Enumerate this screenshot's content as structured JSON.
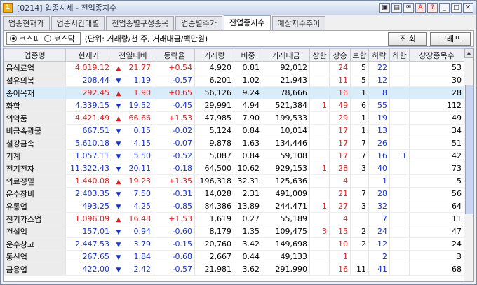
{
  "window": {
    "title": "[0214] 업종시세 - 전업종지수",
    "app_icon": "1"
  },
  "title_buttons": [
    "▣",
    "▤",
    "✉",
    "A",
    "?",
    "_",
    "□",
    "✕"
  ],
  "tabs": [
    {
      "label": "업종현재가"
    },
    {
      "label": "업종시간대별"
    },
    {
      "label": "전업종별구성종목"
    },
    {
      "label": "업종별주가"
    },
    {
      "label": "전업종지수"
    },
    {
      "label": "예상지수추이"
    }
  ],
  "active_tab": 4,
  "market": {
    "option1": "코스피",
    "option2": "코스닥",
    "selected": "코스피"
  },
  "unit_text": "(단위: 거래량/천 주, 거래대금/백만원)",
  "buttons": {
    "query": "조  회",
    "graph": "그래프"
  },
  "colors": {
    "up": "#e02020",
    "down": "#1530d0",
    "selected_row": "#d9ecfa"
  },
  "columns": [
    "업종명",
    "현재가",
    "전일대비",
    "등락율",
    "거래량",
    "비중",
    "거래대금",
    "상한",
    "상승",
    "보합",
    "하락",
    "하한",
    "상장종목수"
  ],
  "rows": [
    {
      "name": "음식료업",
      "price": "4,019.12",
      "dir": "up",
      "change": "21.77",
      "rate": "+0.54",
      "volume": "4,920",
      "weight": "0.81",
      "amount": "92,012",
      "upper": "",
      "rise": "24",
      "flat": "5",
      "fall": "22",
      "lower": "",
      "listed": "53"
    },
    {
      "name": "섬유의복",
      "price": "208.44",
      "dir": "down",
      "change": "1.19",
      "rate": "-0.57",
      "volume": "6,201",
      "weight": "1.02",
      "amount": "21,943",
      "upper": "",
      "rise": "11",
      "flat": "5",
      "fall": "12",
      "lower": "",
      "listed": "30"
    },
    {
      "name": "종이목재",
      "price": "292.45",
      "dir": "up",
      "change": "1.90",
      "rate": "+0.65",
      "volume": "56,126",
      "weight": "9.24",
      "amount": "78,666",
      "upper": "",
      "rise": "16",
      "flat": "1",
      "fall": "8",
      "lower": "",
      "listed": "28"
    },
    {
      "name": "화학",
      "price": "4,339.15",
      "dir": "down",
      "change": "19.52",
      "rate": "-0.45",
      "volume": "29,991",
      "weight": "4.94",
      "amount": "521,384",
      "upper": "1",
      "rise": "49",
      "flat": "6",
      "fall": "55",
      "lower": "",
      "listed": "112"
    },
    {
      "name": "의약품",
      "price": "4,421.49",
      "dir": "up",
      "change": "66.66",
      "rate": "+1.53",
      "volume": "47,985",
      "weight": "7.90",
      "amount": "199,533",
      "upper": "",
      "rise": "29",
      "flat": "1",
      "fall": "19",
      "lower": "",
      "listed": "49"
    },
    {
      "name": "비금속광물",
      "price": "667.51",
      "dir": "down",
      "change": "0.15",
      "rate": "-0.02",
      "volume": "5,124",
      "weight": "0.84",
      "amount": "10,014",
      "upper": "",
      "rise": "17",
      "flat": "1",
      "fall": "13",
      "lower": "",
      "listed": "34"
    },
    {
      "name": "철강금속",
      "price": "5,610.18",
      "dir": "down",
      "change": "4.15",
      "rate": "-0.07",
      "volume": "9,878",
      "weight": "1.63",
      "amount": "134,446",
      "upper": "",
      "rise": "17",
      "flat": "7",
      "fall": "26",
      "lower": "",
      "listed": "51"
    },
    {
      "name": "기계",
      "price": "1,057.11",
      "dir": "down",
      "change": "5.50",
      "rate": "-0.52",
      "volume": "5,087",
      "weight": "0.84",
      "amount": "59,108",
      "upper": "",
      "rise": "17",
      "flat": "7",
      "fall": "16",
      "lower": "1",
      "listed": "42"
    },
    {
      "name": "전기전자",
      "price": "11,322.43",
      "dir": "down",
      "change": "20.11",
      "rate": "-0.18",
      "volume": "64,500",
      "weight": "10.62",
      "amount": "929,153",
      "upper": "1",
      "rise": "28",
      "flat": "3",
      "fall": "40",
      "lower": "",
      "listed": "73"
    },
    {
      "name": "의료정밀",
      "price": "1,440.08",
      "dir": "up",
      "change": "19.23",
      "rate": "+1.35",
      "volume": "196,318",
      "weight": "32.31",
      "amount": "125,636",
      "upper": "",
      "rise": "4",
      "flat": "",
      "fall": "1",
      "lower": "",
      "listed": "5"
    },
    {
      "name": "운수장비",
      "price": "2,403.35",
      "dir": "down",
      "change": "7.50",
      "rate": "-0.31",
      "volume": "14,028",
      "weight": "2.31",
      "amount": "491,009",
      "upper": "",
      "rise": "21",
      "flat": "7",
      "fall": "28",
      "lower": "",
      "listed": "56"
    },
    {
      "name": "유통업",
      "price": "493.25",
      "dir": "down",
      "change": "4.25",
      "rate": "-0.85",
      "volume": "84,386",
      "weight": "13.89",
      "amount": "244,471",
      "upper": "1",
      "rise": "27",
      "flat": "3",
      "fall": "32",
      "lower": "",
      "listed": "64"
    },
    {
      "name": "전기가스업",
      "price": "1,096.09",
      "dir": "up",
      "change": "16.48",
      "rate": "+1.53",
      "volume": "1,619",
      "weight": "0.27",
      "amount": "55,189",
      "upper": "",
      "rise": "4",
      "flat": "",
      "fall": "7",
      "lower": "",
      "listed": "11"
    },
    {
      "name": "건설업",
      "price": "157.01",
      "dir": "down",
      "change": "0.94",
      "rate": "-0.60",
      "volume": "8,179",
      "weight": "1.35",
      "amount": "109,475",
      "upper": "3",
      "rise": "15",
      "flat": "2",
      "fall": "24",
      "lower": "",
      "listed": "47"
    },
    {
      "name": "운수창고",
      "price": "2,447.53",
      "dir": "down",
      "change": "3.79",
      "rate": "-0.15",
      "volume": "20,760",
      "weight": "3.42",
      "amount": "149,698",
      "upper": "",
      "rise": "10",
      "flat": "2",
      "fall": "12",
      "lower": "",
      "listed": "24"
    },
    {
      "name": "통신업",
      "price": "267.65",
      "dir": "down",
      "change": "1.84",
      "rate": "-0.68",
      "volume": "2,667",
      "weight": "0.44",
      "amount": "49,133",
      "upper": "",
      "rise": "1",
      "flat": "",
      "fall": "2",
      "lower": "",
      "listed": "3"
    },
    {
      "name": "금융업",
      "price": "422.00",
      "dir": "down",
      "change": "2.42",
      "rate": "-0.57",
      "volume": "21,981",
      "weight": "3.62",
      "amount": "291,990",
      "upper": "",
      "rise": "16",
      "flat": "11",
      "fall": "41",
      "lower": "",
      "listed": "68"
    }
  ],
  "selected_row": 2
}
